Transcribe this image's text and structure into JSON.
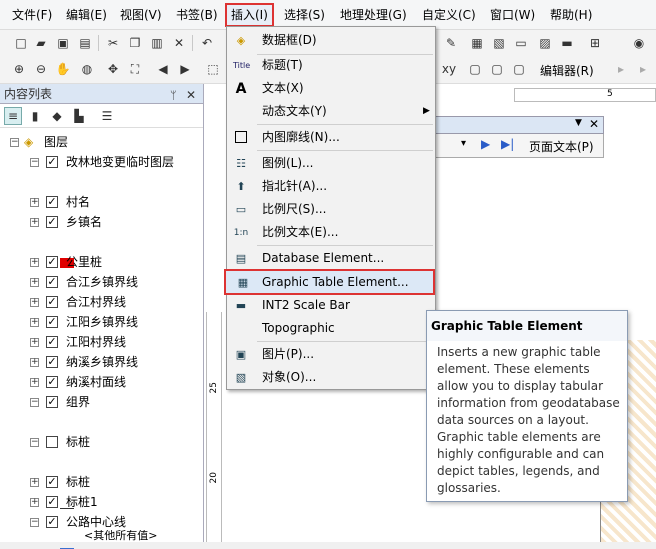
{
  "menubar": {
    "file": "文件(F)",
    "edit": "编辑(E)",
    "view": "视图(V)",
    "bookmark": "书签(B)",
    "insert": "插入(I)",
    "select": "选择(S)",
    "geoprocessing": "地理处理(G)",
    "customize": "自定义(C)",
    "window": "窗口(W)",
    "help": "帮助(H)"
  },
  "toolbar": {
    "editor_label": "编辑器(R)"
  },
  "toc": {
    "title": "内容列表",
    "root": "图层",
    "layers": [
      "改林地变更临时图层",
      "村名",
      "乡镇名",
      "公里桩",
      "合江乡镇界线",
      "合江村界线",
      "江阳乡镇界线",
      "江阳村界线",
      "纳溪乡镇界线",
      "纳溪村面线",
      "组界",
      "标桩",
      "标桩",
      "标桩1",
      "公路中心线",
      "<其他所有值>"
    ]
  },
  "layout_toolbar": {
    "page_text": "页面文本(P)"
  },
  "ruler": {
    "h_mark": "5",
    "v_mark1": "25",
    "v_mark2": "20"
  },
  "insert_menu": {
    "items": [
      {
        "label": "数据框(D)",
        "icon": "data-frame-icon"
      },
      {
        "label": "标题(T)",
        "icon": "title-icon"
      },
      {
        "label": "文本(X)",
        "icon": "text-icon"
      },
      {
        "label": "动态文本(Y)",
        "icon": ""
      },
      {
        "label": "内图廓线(N)...",
        "icon": "neatline-icon"
      },
      {
        "label": "图例(L)...",
        "icon": "legend-icon"
      },
      {
        "label": "指北针(A)...",
        "icon": "north-arrow-icon"
      },
      {
        "label": "比例尺(S)...",
        "icon": "scale-bar-icon"
      },
      {
        "label": "比例文本(E)...",
        "icon": "scale-text-icon"
      },
      {
        "label": "Database Element...",
        "icon": "database-element-icon"
      },
      {
        "label": "Graphic Table Element...",
        "icon": "graphic-table-icon"
      },
      {
        "label": "INT2 Scale Bar",
        "icon": "int2-scale-bar-icon"
      },
      {
        "label": "Topographic",
        "icon": ""
      },
      {
        "label": "图片(P)...",
        "icon": "picture-icon"
      },
      {
        "label": "对象(O)...",
        "icon": "object-icon"
      }
    ],
    "highlight_color": "#d33333"
  },
  "tooltip": {
    "title": "Graphic Table Element",
    "body": "Inserts a new graphic table element. These elements allow you to display tabular information from geodatabase data sources on a layout. Graphic table elements are highly configurable and can depict tables, legends, and glossaries."
  }
}
